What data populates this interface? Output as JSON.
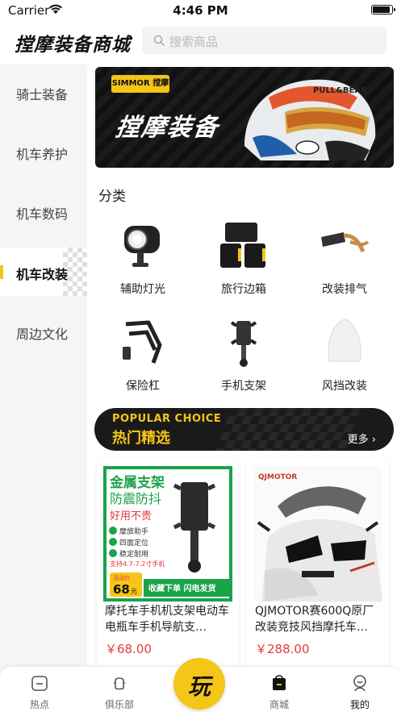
{
  "status_bar": {
    "carrier": "Carrier",
    "time": "4:46 PM"
  },
  "header": {
    "title": "摚摩装备商城",
    "search_placeholder": "搜索商品"
  },
  "sidebar": {
    "items": [
      {
        "label": "骑士装备",
        "active": false
      },
      {
        "label": "机车养护",
        "active": false
      },
      {
        "label": "机车数码",
        "active": false
      },
      {
        "label": "机车改装",
        "active": true
      },
      {
        "label": "周边文化",
        "active": false
      }
    ]
  },
  "banner": {
    "logo_text": "SIMMOR 摚摩",
    "slogan": "摚摩装备",
    "helmet_text": "PULL&BEAR"
  },
  "category": {
    "title": "分类",
    "items": [
      {
        "label": "辅助灯光",
        "icon": "spotlight-icon"
      },
      {
        "label": "旅行边箱",
        "icon": "luggage-box-icon"
      },
      {
        "label": "改装排气",
        "icon": "exhaust-pipe-icon"
      },
      {
        "label": "保险杠",
        "icon": "bumper-icon"
      },
      {
        "label": "手机支架",
        "icon": "phone-mount-icon"
      },
      {
        "label": "风挡改装",
        "icon": "windshield-icon"
      }
    ]
  },
  "popular": {
    "title_en": "POPULAR CHOICE",
    "title_zh": "热门精选",
    "more": "更多"
  },
  "products": [
    {
      "name": "摩托车手机机支架电动车电瓶车手机导航支…",
      "price": "￥68.00",
      "img_headline": "金属支架",
      "img_sub": "防震防抖",
      "img_cheap": "好用不贵",
      "img_features": [
        "摩旅助手",
        "四面定位",
        "稳定耐用"
      ],
      "img_support": "支持4.7-7.2寸手机",
      "img_promo": "活动价",
      "img_price": "68",
      "img_unit": "元",
      "img_cta": "收藏下单 闪电发货"
    },
    {
      "name": "QJMOTOR赛600Q原厂改装竞技风挡摩托车…",
      "price": "￥288.00",
      "img_brand": "QJMOTOR"
    }
  ],
  "tabbar": {
    "items": [
      {
        "label": "热点",
        "icon": "hot-topics-icon"
      },
      {
        "label": "俱乐部",
        "icon": "club-icon"
      },
      {
        "label": "玩",
        "icon": "play-icon"
      },
      {
        "label": "商城",
        "icon": "shop-bag-icon"
      },
      {
        "label": "我的",
        "icon": "profile-icon"
      }
    ]
  },
  "colors": {
    "accent": "#f5c518",
    "price": "#e4393c",
    "sidebar_bg": "#f5f5f5",
    "banner_bg": "#111111"
  }
}
